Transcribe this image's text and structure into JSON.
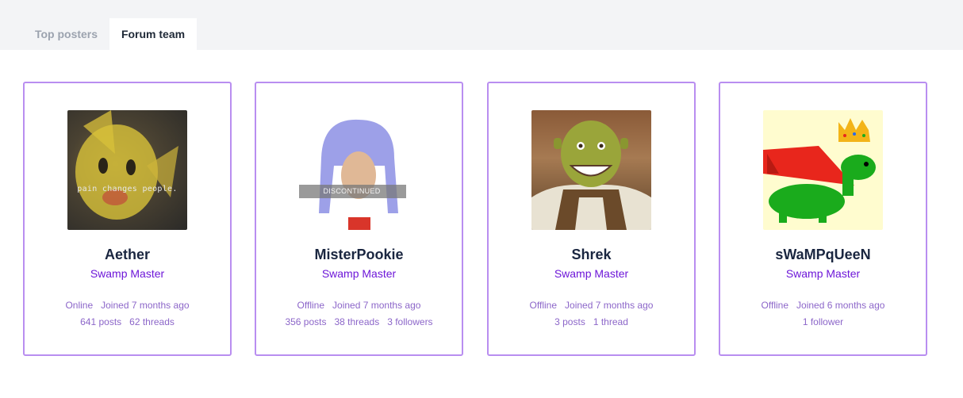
{
  "tabs": {
    "top_posters": "Top posters",
    "forum_team": "Forum team"
  },
  "members": [
    {
      "name": "Aether",
      "role": "Swamp Master",
      "status": "Online",
      "joined": "Joined 7 months ago",
      "stats": [
        "641 posts",
        "62 threads"
      ],
      "avatar_caption": "pain changes people."
    },
    {
      "name": "MisterPookie",
      "role": "Swamp Master",
      "status": "Offline",
      "joined": "Joined 7 months ago",
      "stats": [
        "356 posts",
        "38 threads",
        "3 followers"
      ],
      "avatar_caption": "DISCONTINUED"
    },
    {
      "name": "Shrek",
      "role": "Swamp Master",
      "status": "Offline",
      "joined": "Joined 7 months ago",
      "stats": [
        "3 posts",
        "1 thread"
      ]
    },
    {
      "name": "sWaMPqUeeN",
      "role": "Swamp Master",
      "status": "Offline",
      "joined": "Joined 6 months ago",
      "stats": [
        "1 follower"
      ]
    }
  ],
  "colors": {
    "card_border": "#b98ef0",
    "role": "#6d16d8",
    "meta": "#8c66c9",
    "name": "#1a2640",
    "tab_inactive": "#9ca3af",
    "tab_bar": "#f3f4f6"
  }
}
